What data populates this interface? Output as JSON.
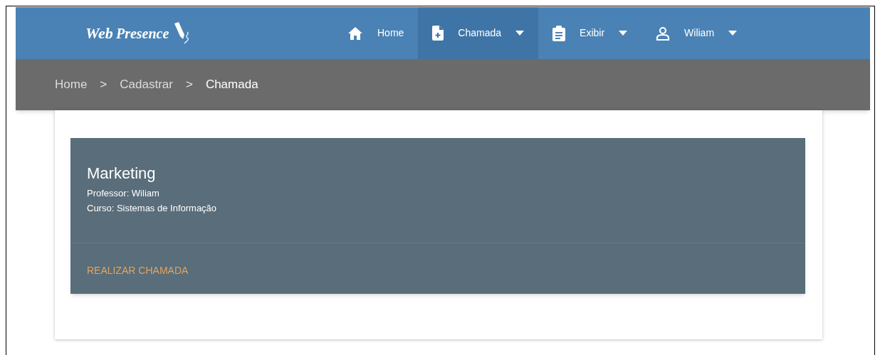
{
  "navbar": {
    "logo": {
      "word_1": "Web",
      "word_2": "Presence"
    },
    "items": [
      {
        "label": "Home",
        "kind": "home",
        "dropdown": false,
        "selected": false
      },
      {
        "label": "Chamada",
        "kind": "document",
        "dropdown": true,
        "selected": true
      },
      {
        "label": "Exibir",
        "kind": "clipboard",
        "dropdown": true,
        "selected": false
      },
      {
        "label": "Wiliam",
        "kind": "user",
        "dropdown": true,
        "selected": false
      }
    ]
  },
  "breadcrumb": [
    {
      "label": "Home",
      "current": false
    },
    {
      "label": "Cadastrar",
      "current": false
    },
    {
      "label": "Chamada",
      "current": true
    }
  ],
  "breadcrumb_separator": ">",
  "course_card": {
    "title": "Marketing",
    "lines": [
      "Professor: Wiliam",
      "Curso: Sistemas de Informação"
    ],
    "action": "REALIZAR CHAMADA"
  }
}
